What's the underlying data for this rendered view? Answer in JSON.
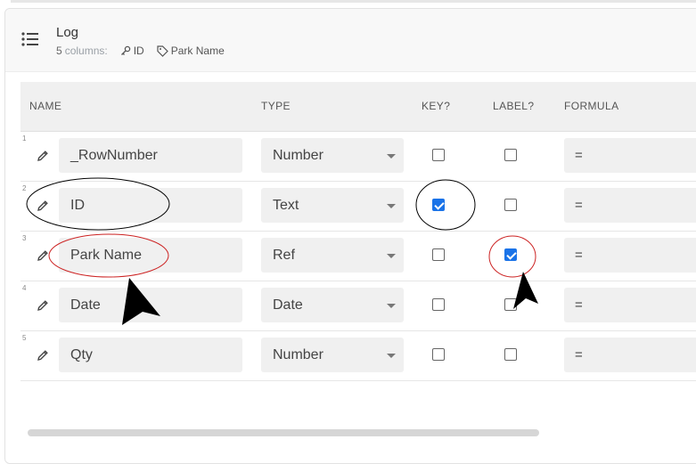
{
  "header": {
    "title": "Log",
    "column_count": "5",
    "columns_word": "columns:",
    "key_column": "ID",
    "label_column": "Park Name"
  },
  "table": {
    "headers": [
      "NAME",
      "TYPE",
      "KEY?",
      "LABEL?",
      "FORMULA"
    ],
    "rows": [
      {
        "num": "1",
        "name": "_RowNumber",
        "type": "Number",
        "key": false,
        "label": false,
        "formula": "="
      },
      {
        "num": "2",
        "name": "ID",
        "type": "Text",
        "key": true,
        "label": false,
        "formula": "="
      },
      {
        "num": "3",
        "name": "Park Name",
        "type": "Ref",
        "key": false,
        "label": true,
        "formula": "="
      },
      {
        "num": "4",
        "name": "Date",
        "type": "Date",
        "key": false,
        "label": false,
        "formula": "="
      },
      {
        "num": "5",
        "name": "Qty",
        "type": "Number",
        "key": false,
        "label": false,
        "formula": "="
      }
    ]
  },
  "annotations": {
    "ellipse_colors": [
      "#000000",
      "#000000",
      "#cc2222",
      "#cc2222"
    ],
    "arrow_color": "#000000"
  },
  "icons": [
    "list-icon",
    "key-icon",
    "tag-icon",
    "pencil-icon",
    "dropdown-caret-icon"
  ]
}
